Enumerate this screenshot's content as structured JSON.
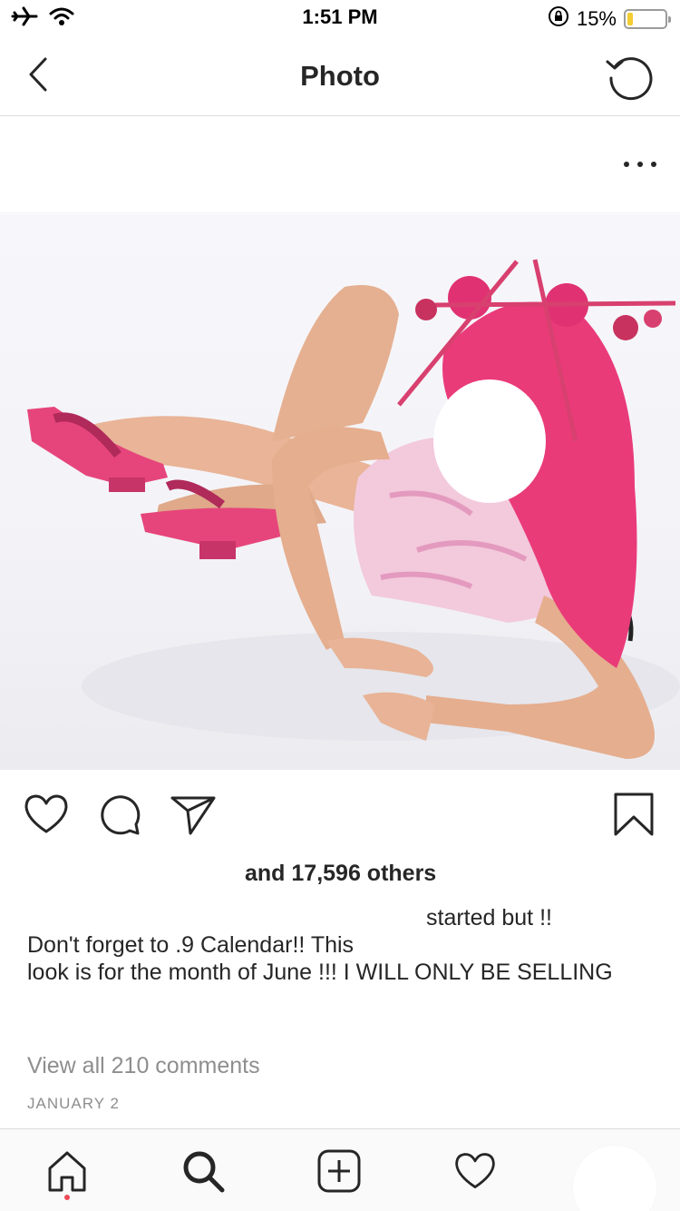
{
  "status_bar": {
    "time": "1:51 PM",
    "battery_percent": "15%",
    "battery_level": 0.15,
    "icons": [
      "airplane-icon",
      "wifi-icon",
      "orientation-lock-icon",
      "battery-icon"
    ]
  },
  "nav": {
    "title": "Photo",
    "back_icon": "chevron-left-icon",
    "refresh_icon": "refresh-icon"
  },
  "post": {
    "more_icon": "more-options-icon",
    "photo_alt": "Photo",
    "actions": [
      "heart-icon",
      "comment-icon",
      "share-icon",
      "bookmark-icon"
    ],
    "likes_text": "and 17,596 others",
    "caption_lines": [
      "started but !!",
      "Don't forget to          .9 Calendar!! This",
      "look is for the month of June !!! I WILL ONLY BE SELLING"
    ],
    "view_comments": "View all 210 comments",
    "date": "JANUARY 2"
  },
  "tab_bar": {
    "items": [
      "home-icon",
      "search-icon",
      "add-post-icon",
      "activity-heart-icon",
      "profile-avatar"
    ],
    "accent_color": "#ed4956"
  },
  "colors": {
    "text_primary": "#262626",
    "text_secondary": "#8e8e8e",
    "divider": "#dbdbdb",
    "battery_yellow": "#f2cd33"
  }
}
